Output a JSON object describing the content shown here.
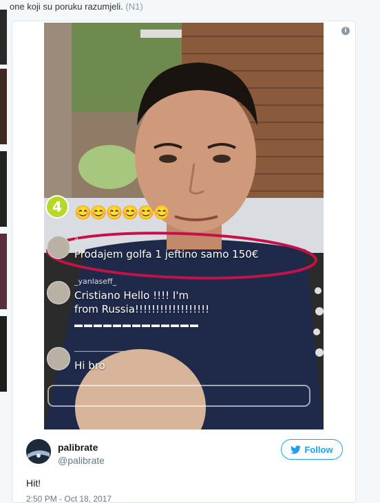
{
  "page": {
    "intro_text": "one koji su poruku razumjeli.",
    "intro_ref": "(N1)"
  },
  "media": {
    "badge": "4",
    "emojis": "😊😊😊😊😊😊",
    "comments": [
      {
        "name": "s_________",
        "message": "Prodajem golfa 1 jeftino samo 150€"
      },
      {
        "name": "_yanlaseff_",
        "message_line1": "Cristiano Hello !!!! I'm",
        "message_line2": "from Russia!!!!!!!!!!!!!!!!!!"
      },
      {
        "name": "_____________",
        "message": "Hi bro"
      }
    ],
    "flags": "▬▬▬▬▬▬▬▬▬▬▬▬▬",
    "colors": {
      "highlight": "#c3124a",
      "badge": "#b6d829"
    }
  },
  "tweet": {
    "author_name": "palibrate",
    "author_handle": "@palibrate",
    "follow_label": "Follow",
    "text": "Hit!",
    "timestamp": "2:50 PM - Oct 18, 2017"
  },
  "colors": {
    "accent": "#1da1f2"
  }
}
